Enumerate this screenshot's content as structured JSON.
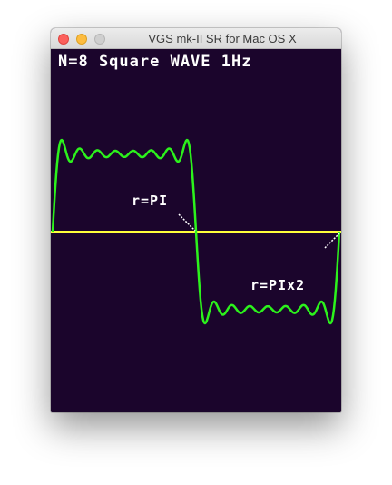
{
  "window": {
    "title": "VGS mk-II SR for Mac OS X"
  },
  "screen": {
    "heading": "N=8 Square WAVE 1Hz",
    "label_pi": "r=PI",
    "label_2pi": "r=PIx2",
    "colors": {
      "background": "#1b052c",
      "wave": "#2cf21c",
      "axis": "#ffff3a",
      "text": "#ffffff"
    },
    "wave": {
      "harmonics": 8,
      "frequency": "1Hz"
    }
  }
}
